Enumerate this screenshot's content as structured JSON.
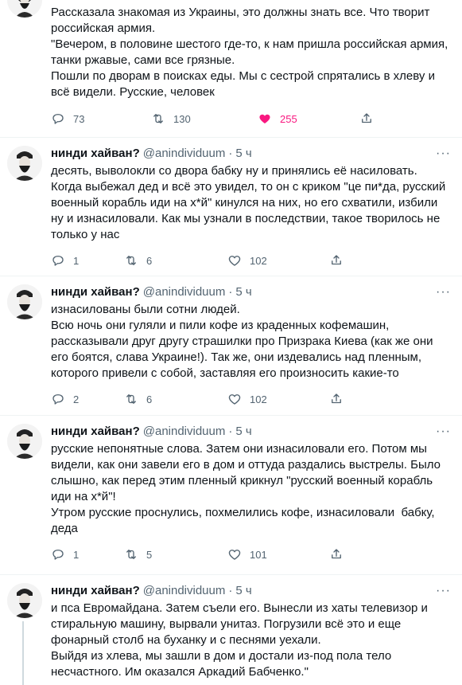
{
  "tweets": [
    {
      "show_header": false,
      "name": "",
      "handle": "",
      "time": "",
      "text": "Рассказала знакомая из Украины, это должны знать все. Что творит российская армия.\n\"Вечером, в половине шестого где-то, к нам пришла российская армия, танки ржавые, сами все грязные.\nПошли по дворам в поисках еды. Мы с сестрой спрятались в хлеву и всё видели. Русские, человек",
      "replies": "73",
      "retweets": "130",
      "likes": "255",
      "liked": true
    },
    {
      "show_header": true,
      "name": "нинди хайван?",
      "handle": "@anindividuum",
      "dot": "·",
      "time": "5 ч",
      "text": "десять, выволокли со двора бабку ну и принялись её насиловать. Когда выбежал дед и всё это увидел, то он с криком \"це пи*да, русский военный корабль иди на х*й\" кинулся на них, но его схватили, избили ну и изнасиловали. Как мы узнали в последствии, такое творилось не только у нас",
      "replies": "1",
      "retweets": "6",
      "likes": "102",
      "liked": false
    },
    {
      "show_header": true,
      "name": "нинди хайван?",
      "handle": "@anindividuum",
      "dot": "·",
      "time": "5 ч",
      "text": "изнасилованы были сотни людей.\nВсю ночь они гуляли и пили кофе из краденных кофемашин, рассказывали друг другу страшилки про Призрака Киева (как же они его боятся, слава Украине!). Так же, они издевались над пленным, которого привели с собой, заставляя его произносить какие-то",
      "replies": "2",
      "retweets": "6",
      "likes": "102",
      "liked": false
    },
    {
      "show_header": true,
      "name": "нинди хайван?",
      "handle": "@anindividuum",
      "dot": "·",
      "time": "5 ч",
      "text": "русские непонятные слова. Затем они изнасиловали его. Потом мы видели, как они завели его в дом и оттуда раздались выстрелы. Было слышно, как перед этим пленный крикнул \"русский военный корабль иди на х*й\"!\nУтром русские проснулись, похмелились кофе, изнасиловали  бабку, деда",
      "replies": "1",
      "retweets": "5",
      "likes": "101",
      "liked": false
    },
    {
      "show_header": true,
      "name": "нинди хайван?",
      "handle": "@anindividuum",
      "dot": "·",
      "time": "5 ч",
      "text": "и пса Евромайдана. Затем съели его. Вынесли из хаты телевизор и стиральную машину, вырвали унитаз. Погрузили всё это и еще фонарный столб на буханку и с песнями уехали.\nВыйдя из хлева, мы зашли в дом и достали из-под пола тело несчастного. Им оказался Аркадий Бабченко.\"",
      "replies": "",
      "retweets": "",
      "likes": "",
      "liked": false,
      "hide_actions": true
    }
  ],
  "more_label": "···",
  "icons": {
    "reply": "reply-icon",
    "retweet": "retweet-icon",
    "like": "heart-icon",
    "share": "share-icon"
  },
  "colors": {
    "text": "#0f1419",
    "secondary": "#536471",
    "like_active": "#f91880",
    "thread_line": "#cfd9de"
  }
}
